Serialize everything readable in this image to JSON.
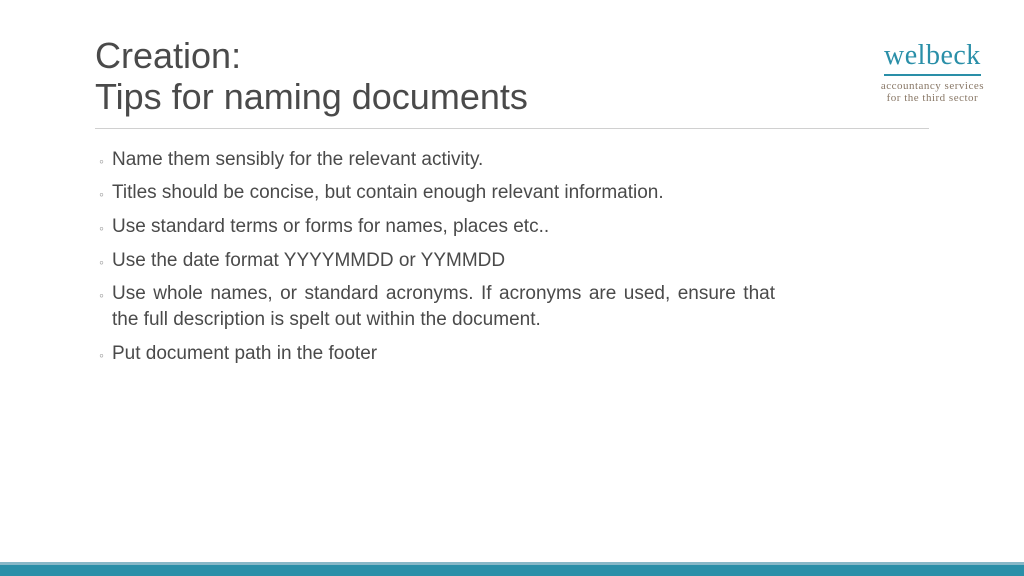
{
  "title": {
    "line1": "Creation:",
    "line2": "Tips for naming documents"
  },
  "logo": {
    "name": "welbeck",
    "tagline1": "accountancy services",
    "tagline2": "for the third sector"
  },
  "bullets": [
    {
      "text": "Name them sensibly for the relevant activity.",
      "justified": false
    },
    {
      "text": "Titles should be concise, but contain enough relevant information.",
      "justified": true
    },
    {
      "text": "Use standard terms or forms for names, places etc..",
      "justified": false
    },
    {
      "text": "Use the date format YYYYMMDD or YYMMDD",
      "justified": false
    },
    {
      "text": "Use whole names, or standard acronyms. If acronyms are used, ensure that the full description is spelt out within the document.",
      "justified": true
    },
    {
      "text": "Put document path in the footer",
      "justified": false
    }
  ]
}
